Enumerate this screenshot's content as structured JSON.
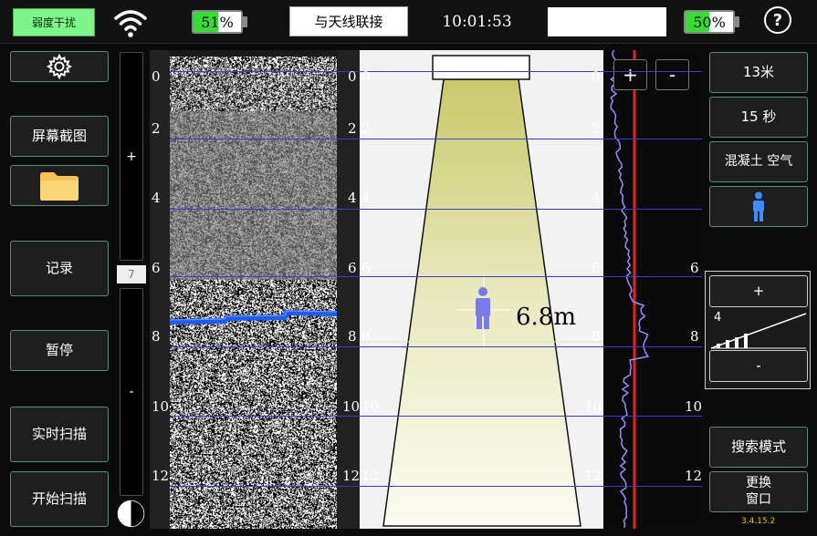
{
  "topbar": {
    "status_pill": "弱度干扰",
    "wifi_icon": "wifi-icon",
    "battery_left": {
      "text": "51%",
      "level": 0.51
    },
    "connect_button": "与天线联接",
    "clock": "10:01:53",
    "battery_right": {
      "text": "50%",
      "level": 0.5
    },
    "help_icon_text": "?"
  },
  "left_buttons": {
    "settings_icon": "gear-icon",
    "screenshot": "屏幕截图",
    "folder_icon": "folder-icon",
    "record": "记录",
    "pause": "暂停",
    "realtime_scan": "实时扫描",
    "start_scan": "开始扫描"
  },
  "gain_slider": {
    "plus": "+",
    "minus": "-",
    "value": "7"
  },
  "depth_axis": {
    "ticks_left": [
      "0",
      "2",
      "4",
      "6",
      "8",
      "10",
      "12"
    ],
    "ticks_right": [
      "0",
      "2",
      "4",
      "6",
      "8",
      "10",
      "12"
    ],
    "ticks_mid": [
      "6",
      "8",
      "10",
      "12"
    ]
  },
  "beam_view": {
    "target_icon": "person-icon",
    "target_distance": "6.8m"
  },
  "waveform": {
    "zoom_in": "+",
    "zoom_out": "-"
  },
  "right_panel": {
    "range": "13米",
    "time": "15 秒",
    "medium": "混凝土  空气",
    "target_icon": "person-icon",
    "sens_plus": "+",
    "sens_value": "4",
    "sens_minus": "-",
    "search_mode": "搜索模式",
    "change_window_line1": "更换",
    "change_window_line2": "窗口",
    "version": "3.4.15.2"
  },
  "colors": {
    "accent_green": "#7df58a",
    "button_border": "#5b8a84",
    "detection_line": "#1e5bff",
    "waveform_red": "#e0241e",
    "waveform_trace": "#9b8cff"
  }
}
